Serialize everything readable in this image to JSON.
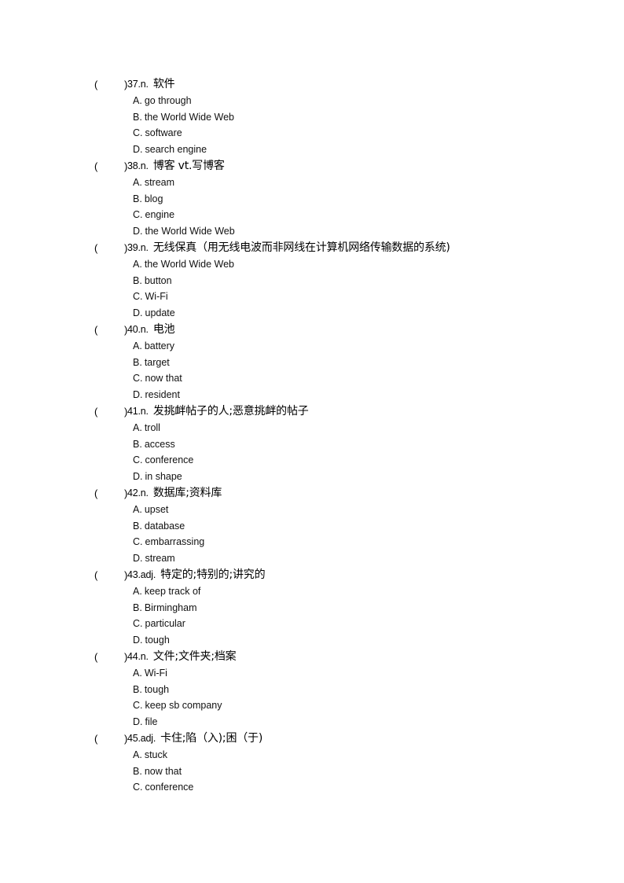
{
  "questions": [
    {
      "number": "37",
      "pos": "n.",
      "meaning": "软件",
      "options": [
        {
          "letter": "A.",
          "text": "go through"
        },
        {
          "letter": "B.",
          "text": "the World Wide  Web"
        },
        {
          "letter": "C.",
          "text": "software"
        },
        {
          "letter": "D.",
          "text": "search engine"
        }
      ]
    },
    {
      "number": "38",
      "pos": "n.",
      "meaning": "博客  vt.写博客",
      "options": [
        {
          "letter": "A.",
          "text": "stream"
        },
        {
          "letter": "B.",
          "text": "blog"
        },
        {
          "letter": "C.",
          "text": "engine"
        },
        {
          "letter": "D.",
          "text": "the World Wide Web"
        }
      ]
    },
    {
      "number": "39",
      "pos": "n.",
      "meaning": "无线保真（用无线电波而非网线在计算机网络传输数据的系统)",
      "options": [
        {
          "letter": "A.",
          "text": "the World  Wide Web"
        },
        {
          "letter": "B.",
          "text": "button"
        },
        {
          "letter": "C.",
          "text": "Wi-Fi"
        },
        {
          "letter": "D.",
          "text": "update"
        }
      ]
    },
    {
      "number": "40",
      "pos": "n.",
      "meaning": "电池",
      "options": [
        {
          "letter": "A.",
          "text": "battery"
        },
        {
          "letter": "B.",
          "text": "target"
        },
        {
          "letter": "C.",
          "text": "now that"
        },
        {
          "letter": "D.",
          "text": "resident"
        }
      ]
    },
    {
      "number": "41",
      "pos": "n.",
      "meaning": "发挑衅帖子的人;恶意挑衅的帖子",
      "options": [
        {
          "letter": "A.",
          "text": "troll"
        },
        {
          "letter": "B.",
          "text": "access"
        },
        {
          "letter": "C.",
          "text": "conference"
        },
        {
          "letter": "D.",
          "text": "in shape"
        }
      ]
    },
    {
      "number": "42",
      "pos": "n.",
      "meaning": "数据库;资料库",
      "options": [
        {
          "letter": "A.",
          "text": "upset"
        },
        {
          "letter": "B.",
          "text": "database"
        },
        {
          "letter": "C.",
          "text": "embarrassing"
        },
        {
          "letter": "D.",
          "text": "stream"
        }
      ]
    },
    {
      "number": "43",
      "pos": "adj.",
      "meaning": "特定的;特别的;讲究的",
      "options": [
        {
          "letter": "A.",
          "text": "keep track of"
        },
        {
          "letter": "B.",
          "text": "Birmingham"
        },
        {
          "letter": "C.",
          "text": "particular"
        },
        {
          "letter": "D.",
          "text": "tough"
        }
      ]
    },
    {
      "number": "44",
      "pos": "n.",
      "meaning": "文件;文件夹;档案",
      "options": [
        {
          "letter": "A.",
          "text": "Wi-Fi"
        },
        {
          "letter": "B.",
          "text": "tough"
        },
        {
          "letter": "C.",
          "text": "keep sb company"
        },
        {
          "letter": "D.",
          "text": "file"
        }
      ]
    },
    {
      "number": "45",
      "pos": "adj.",
      "meaning": "卡住;陷（入);困（于)",
      "options": [
        {
          "letter": "A.",
          "text": "stuck"
        },
        {
          "letter": "B.",
          "text": "now that"
        },
        {
          "letter": "C.",
          "text": "conference"
        }
      ]
    }
  ],
  "labels": {
    "paren_open": "(",
    "paren_close": ")"
  }
}
